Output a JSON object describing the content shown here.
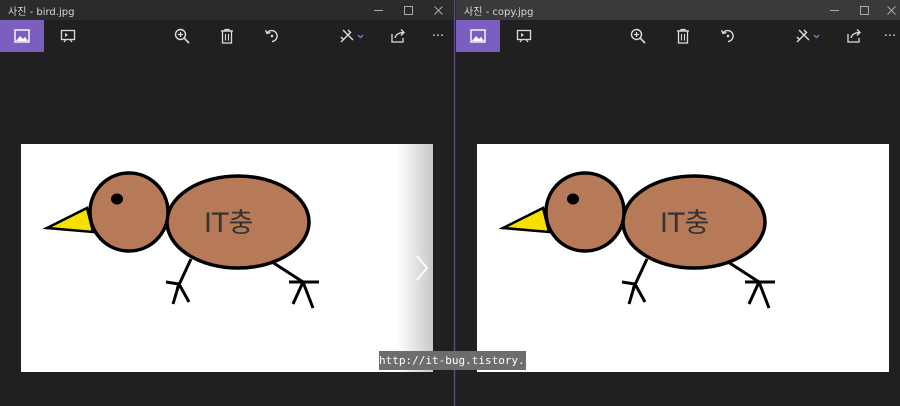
{
  "windows": [
    {
      "title": "사진 - bird.jpg",
      "image": {
        "text": "IT충"
      }
    },
    {
      "title": "사진 - copy.jpg",
      "image": {
        "text": "IT충"
      }
    }
  ],
  "toolbar_icons": [
    "photo-view-icon",
    "slideshow-icon",
    "zoom-in-icon",
    "delete-icon",
    "rotate-icon",
    "edit-draw-icon",
    "share-icon",
    "more-icon"
  ],
  "colors": {
    "accent": "#7b5fc0",
    "bird_body": "#b77a58",
    "beak": "#f5e000",
    "background": "#202020"
  },
  "watermark": "http://it-bug.tistory.com",
  "more_label": "···"
}
